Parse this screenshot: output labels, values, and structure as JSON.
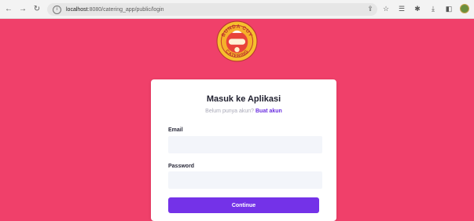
{
  "browser": {
    "url_host": "localhost",
    "url_rest": ":8080/catering_app/public/login"
  },
  "logo": {
    "top_text": "BUNDA CUY",
    "bottom_text": "CATERING"
  },
  "login": {
    "title": "Masuk ke Aplikasi",
    "subtitle_text": "Belum punya akun?",
    "subtitle_link": "Buat akun",
    "email_label": "Email",
    "email_value": "",
    "password_label": "Password",
    "password_value": "",
    "continue_label": "Continue"
  },
  "colors": {
    "background": "#f0406a",
    "accent": "#7432e8"
  },
  "icons": {
    "back": "arrow-left-icon",
    "forward": "arrow-right-icon",
    "reload": "reload-icon",
    "info": "info-icon",
    "share": "share-icon",
    "bookmark": "star-icon",
    "reading": "reading-list-icon",
    "extensions": "puzzle-icon",
    "download": "download-icon",
    "split": "split-view-icon",
    "profile": "profile-avatar-icon"
  }
}
